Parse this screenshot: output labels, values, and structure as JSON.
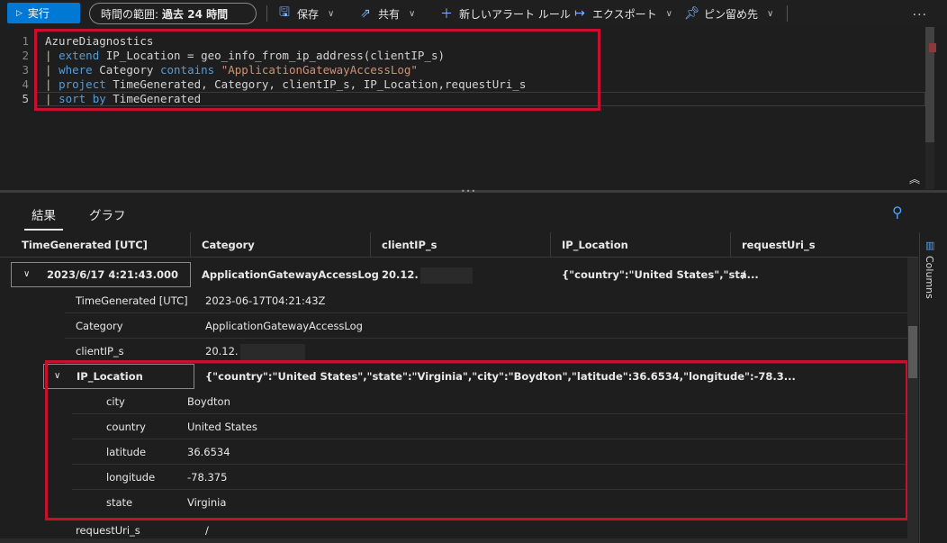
{
  "toolbar": {
    "run_label": "実行",
    "time_range_label": "時間の範囲:",
    "time_range_value": "過去 24 時間",
    "save_label": "保存",
    "share_label": "共有",
    "new_alert_label": "新しいアラート ルール",
    "export_label": "エクスポート",
    "pin_label": "ピン留め先",
    "more_label": "..."
  },
  "editor": {
    "line_numbers": [
      "1",
      "2",
      "3",
      "4",
      "5"
    ]
  },
  "results": {
    "tabs": [
      "結果",
      "グラフ"
    ],
    "columns": [
      "TimeGenerated [UTC]",
      "Category",
      "clientIP_s",
      "IP_Location",
      "requestUri_s"
    ],
    "row": {
      "time": "2023/6/17 4:21:43.000",
      "category": "ApplicationGatewayAccessLog",
      "clientip": "20.12.",
      "ip_location": "{\"country\":\"United States\",\"sta...",
      "requesturi": "/"
    },
    "details": [
      {
        "key": "TimeGenerated [UTC]",
        "value": "2023-06-17T04:21:43Z"
      },
      {
        "key": "Category",
        "value": "ApplicationGatewayAccessLog"
      },
      {
        "key": "clientIP_s",
        "value": "20.12."
      }
    ],
    "ip_location": {
      "key": "IP_Location",
      "value": "{\"country\":\"United States\",\"state\":\"Virginia\",\"city\":\"Boydton\",\"latitude\":36.6534,\"longitude\":-78.3...",
      "fields": [
        {
          "key": "city",
          "value": "Boydton"
        },
        {
          "key": "country",
          "value": "United States"
        },
        {
          "key": "latitude",
          "value": "36.6534"
        },
        {
          "key": "longitude",
          "value": "-78.375"
        },
        {
          "key": "state",
          "value": "Virginia"
        }
      ]
    },
    "request_uri": {
      "key": "requestUri_s",
      "value": "/"
    },
    "columns_panel_label": "Columns"
  },
  "colors": {
    "accent": "#0078d4",
    "highlight": "#c8102e"
  }
}
